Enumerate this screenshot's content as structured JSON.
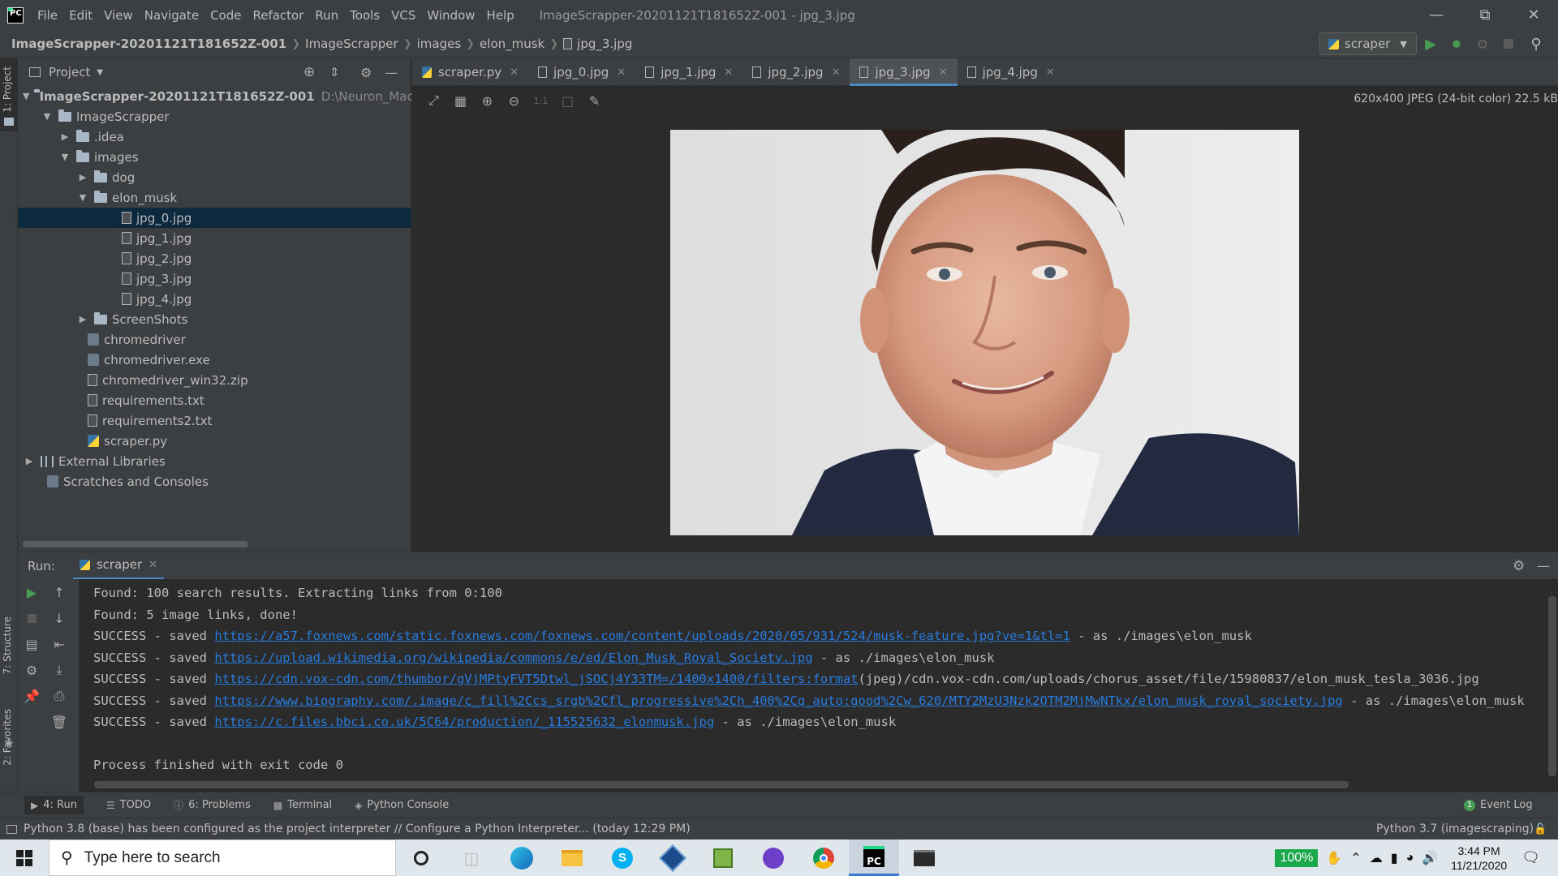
{
  "titlebar": {
    "menu": [
      "File",
      "Edit",
      "View",
      "Navigate",
      "Code",
      "Refactor",
      "Run",
      "Tools",
      "VCS",
      "Window",
      "Help"
    ],
    "title": "ImageScrapper-20201121T181652Z-001 - jpg_3.jpg"
  },
  "navbar": {
    "crumbs": [
      "ImageScrapper-20201121T181652Z-001",
      "ImageScrapper",
      "images",
      "elon_musk",
      "jpg_3.jpg"
    ],
    "run_config": "scraper"
  },
  "left_stripe": {
    "project_tab": "1: Project",
    "structure_tab": "7: Structure",
    "favorites_tab": "2: Favorites"
  },
  "project": {
    "header": "Project",
    "tree": [
      {
        "label": "ImageScrapper-20201121T181652Z-001",
        "path": "D:\\Neuron_Machine",
        "bold": true
      },
      {
        "label": "ImageScrapper"
      },
      {
        "label": ".idea"
      },
      {
        "label": "images"
      },
      {
        "label": "dog"
      },
      {
        "label": "elon_musk"
      },
      {
        "label": "jpg_0.jpg"
      },
      {
        "label": "jpg_1.jpg"
      },
      {
        "label": "jpg_2.jpg"
      },
      {
        "label": "jpg_3.jpg"
      },
      {
        "label": "jpg_4.jpg"
      },
      {
        "label": "ScreenShots"
      },
      {
        "label": "chromedriver"
      },
      {
        "label": "chromedriver.exe"
      },
      {
        "label": "chromedriver_win32.zip"
      },
      {
        "label": "requirements.txt"
      },
      {
        "label": "requirements2.txt"
      },
      {
        "label": "scraper.py"
      },
      {
        "label": "External Libraries"
      },
      {
        "label": "Scratches and Consoles"
      }
    ]
  },
  "tabs": [
    "scraper.py",
    "jpg_0.jpg",
    "jpg_1.jpg",
    "jpg_2.jpg",
    "jpg_3.jpg",
    "jpg_4.jpg"
  ],
  "image_info": "620x400 JPEG (24-bit color) 22.5 kB",
  "run": {
    "label": "Run:",
    "tab": "scraper",
    "lines": {
      "l1": "Found: 100 search results. Extracting links from 0:100",
      "l2": "Found: 5 image links, done!",
      "success_prefix": "SUCCESS - saved ",
      "link1": "https://a57.foxnews.com/static.foxnews.com/foxnews.com/content/uploads/2020/05/931/524/musk-feature.jpg?ve=1&tl=1",
      "suffix1": " - as ./images\\elon_musk",
      "link2": "https://upload.wikimedia.org/wikipedia/commons/e/ed/Elon_Musk_Royal_Society.jpg",
      "suffix2": " - as ./images\\elon_musk",
      "link3": "https://cdn.vox-cdn.com/thumbor/gVjMPtyFVT5Dtwl_jSOCj4Y33TM=/1400x1400/filters:format",
      "suffix3": "(jpeg)/cdn.vox-cdn.com/uploads/chorus_asset/file/15980837/elon_musk_tesla_3036.jpg",
      "link4": "https://www.biography.com/.image/c_fill%2Ccs_srgb%2Cfl_progressive%2Ch_400%2Cq_auto:good%2Cw_620/MTY2MzU3Nzk2OTM2MjMwNTkx/elon_musk_royal_society.jpg",
      "suffix4": " - as ./images\\elon_musk",
      "link5": "https://c.files.bbci.co.uk/5C64/production/_115525632_elonmusk.jpg",
      "suffix5": " - as ./images\\elon_musk",
      "exit": "Process finished with exit code 0"
    }
  },
  "bottom_tabs": {
    "run": "4: Run",
    "todo": "TODO",
    "problems": "6: Problems",
    "terminal": "Terminal",
    "python_console": "Python Console",
    "event_log": "Event Log",
    "event_count": "1"
  },
  "status": {
    "message": "Python 3.8 (base) has been configured as the project interpreter // Configure a Python Interpreter... (today 12:29 PM)",
    "interpreter": "Python 3.7 (imagescraping)"
  },
  "taskbar": {
    "search_placeholder": "Type here to search",
    "battery": "100%",
    "time": "3:44 PM",
    "date": "11/21/2020"
  },
  "colors": {
    "accent": "#4a88c7",
    "link": "#287bde",
    "selection": "#0d293e",
    "run_green": "#499c54"
  }
}
